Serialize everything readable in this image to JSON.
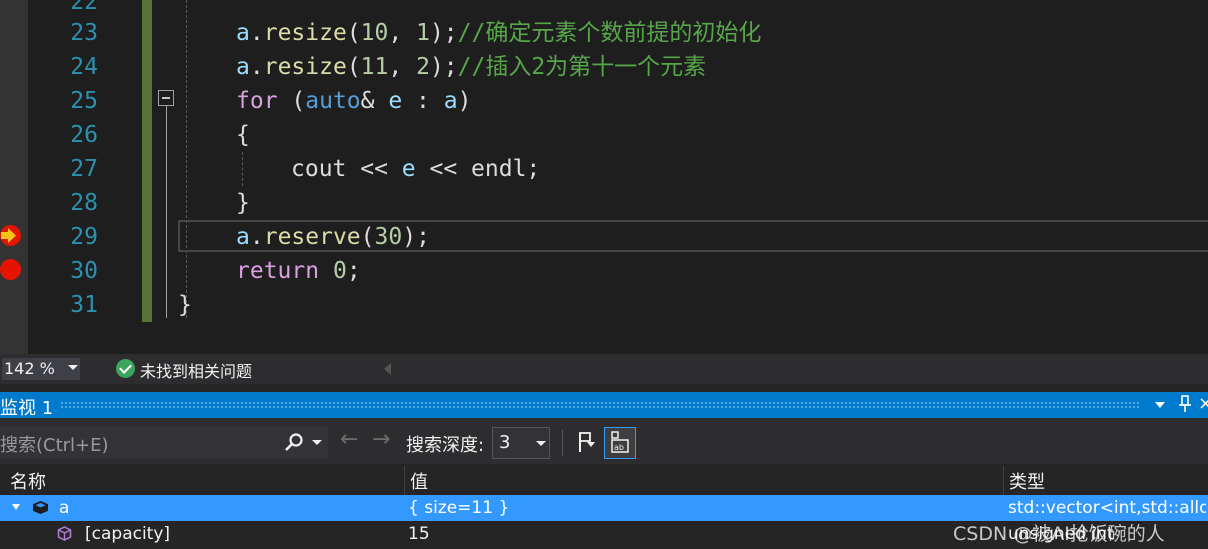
{
  "editor": {
    "line_numbers": [
      "22",
      "23",
      "24",
      "25",
      "26",
      "27",
      "28",
      "29",
      "30",
      "31"
    ],
    "lines": {
      "l23": {
        "obj": "a",
        "dot": ".",
        "method": "resize",
        "open": "(",
        "arg1": "10",
        "comma": ", ",
        "arg2": "1",
        "close": ");",
        "comment": "//确定元素个数前提的初始化"
      },
      "l24": {
        "obj": "a",
        "dot": ".",
        "method": "resize",
        "open": "(",
        "arg1": "11",
        "comma": ", ",
        "arg2": "2",
        "close": ");",
        "comment": "//插入2为第十一个元素"
      },
      "l25": {
        "keyword": "for",
        "space": " (",
        "type": "auto",
        "amp": "& ",
        "var": "e",
        "colon": " : ",
        "range": "a",
        "close": ")"
      },
      "l26": {
        "text": "{"
      },
      "l27": {
        "cout": "cout",
        "op1": " << ",
        "var": "e",
        "op2": " << ",
        "endl": "endl",
        "semi": ";"
      },
      "l28": {
        "text": "}"
      },
      "l29": {
        "obj": "a",
        "dot": ".",
        "method": "reserve",
        "open": "(",
        "arg": "30",
        "close": ");"
      },
      "l30": {
        "keyword": "return",
        "space": " ",
        "value": "0",
        "semi": ";"
      },
      "l31": {
        "text": "}"
      }
    },
    "colors": {
      "keyword": "#569cd6",
      "control": "#d8a0df",
      "function": "#dcdcaa",
      "variable": "#9cdcfe",
      "comment": "#57a64a",
      "number": "#b5cea8",
      "line_number": "#2b91af",
      "breakpoint": "#e51400"
    }
  },
  "status": {
    "zoom": "142 %",
    "issues": "未找到相关问题"
  },
  "watch": {
    "title": "监视 1",
    "search_placeholder": "搜索(Ctrl+E)",
    "depth_label": "搜索深度:",
    "depth_value": "3",
    "columns": {
      "name": "名称",
      "value": "值",
      "type": "类型"
    },
    "rows": [
      {
        "name": "a",
        "value": "{ size=11 }",
        "type": "std::vector<int,std::allo..."
      },
      {
        "name": "[capacity]",
        "value": "15",
        "type": "unsigned int"
      }
    ]
  },
  "watermark": "CSDN @被AI抢饭碗的人"
}
